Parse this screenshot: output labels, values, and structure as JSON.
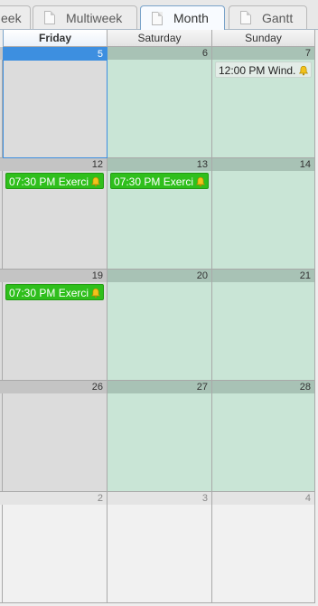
{
  "tabs": [
    {
      "label": "eek",
      "active": false
    },
    {
      "label": "Multiweek",
      "active": false
    },
    {
      "label": "Month",
      "active": true
    },
    {
      "label": "Gantt",
      "active": false
    }
  ],
  "columns": [
    "Friday",
    "Saturday",
    "Sunday"
  ],
  "weeks": [
    {
      "days": [
        {
          "num": "5",
          "selected": true
        },
        {
          "num": "6"
        },
        {
          "num": "7",
          "events": [
            {
              "text": "12:00 PM Wind...",
              "style": "plain",
              "alarm": true
            }
          ]
        }
      ]
    },
    {
      "days": [
        {
          "num": "12",
          "events": [
            {
              "text": "07:30 PM Exerci...",
              "style": "green",
              "alarm": true
            }
          ]
        },
        {
          "num": "13",
          "events": [
            {
              "text": "07:30 PM Exerci...",
              "style": "green",
              "alarm": true
            }
          ]
        },
        {
          "num": "14"
        }
      ]
    },
    {
      "days": [
        {
          "num": "19",
          "events": [
            {
              "text": "07:30 PM Exerci...",
              "style": "green",
              "alarm": true
            }
          ]
        },
        {
          "num": "20"
        },
        {
          "num": "21"
        }
      ]
    },
    {
      "days": [
        {
          "num": "26"
        },
        {
          "num": "27"
        },
        {
          "num": "28"
        }
      ]
    },
    {
      "days": [
        {
          "num": "2",
          "other_month": true
        },
        {
          "num": "3",
          "other_month": true
        },
        {
          "num": "4",
          "other_month": true
        }
      ]
    }
  ],
  "colors": {
    "selected": "#3d8fe0",
    "event_green": "#2fbf1c",
    "weekend": "#c9e5d6",
    "weekday": "#dcdcdc"
  },
  "icons": {
    "tab": "document-icon",
    "alarm": "bell-icon"
  }
}
